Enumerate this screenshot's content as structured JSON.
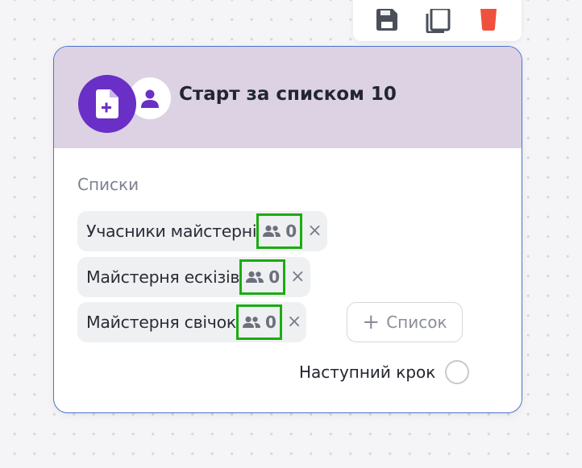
{
  "toolbar": {
    "icons": [
      "save-icon",
      "copy-icon",
      "delete-icon"
    ]
  },
  "node": {
    "title": "Старт за списком 10",
    "icons": [
      "file-add-icon",
      "user-icon"
    ],
    "section_label": "Списки",
    "lists": [
      {
        "name": "Учасники майстерні",
        "count": "0"
      },
      {
        "name": "Майстерня ескізів",
        "count": "0"
      },
      {
        "name": "Майстерня свічок",
        "count": "0"
      }
    ],
    "remove_symbol": "×",
    "add_button": {
      "plus": "+",
      "label": "Список"
    },
    "next_step_label": "Наступний крок"
  },
  "colors": {
    "accent_purple": "#6a2fc6",
    "header_bg": "#dcd2e4",
    "card_border": "#4a72d1",
    "highlight_green": "#1aac10",
    "delete_red": "#f0513c"
  }
}
